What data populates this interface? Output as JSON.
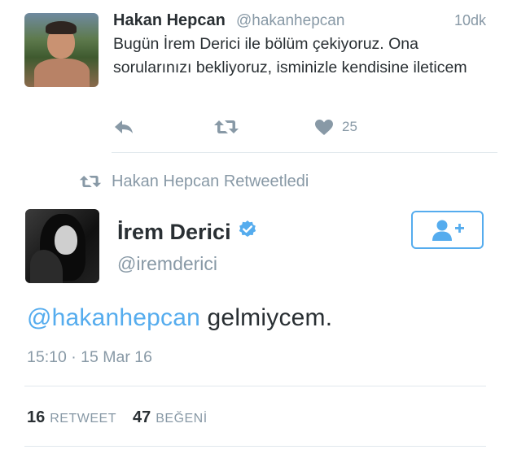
{
  "tweet1": {
    "name": "Hakan Hepcan",
    "handle": "@hakanhepcan",
    "time": "10dk",
    "text": "Bugün İrem Derici ile bölüm çekiyoruz. Ona sorularınızı bekliyoruz, isminizle kendisine ileticem",
    "like_count": "25",
    "icons": {
      "reply": "reply-icon",
      "retweet": "retweet-icon",
      "like": "heart-icon"
    }
  },
  "retweet_context": {
    "label": "Hakan Hepcan Retweetledi",
    "icon": "retweet-icon"
  },
  "tweet2": {
    "name": "İrem Derici",
    "handle": "@iremderici",
    "verified_icon": "verified-badge-icon",
    "follow_icon": "add-user-icon",
    "mention": "@hakanhepcan",
    "text": " gelmiycem.",
    "timestamp": "15:10 · 15 Mar 16",
    "retweet_count": "16",
    "retweet_label": "RETWEET",
    "like_count": "47",
    "like_label": "BEĞENİ"
  },
  "colors": {
    "accent": "#55acee",
    "muted": "#8899a6",
    "text": "#292f33",
    "divider": "#e1e8ed"
  }
}
